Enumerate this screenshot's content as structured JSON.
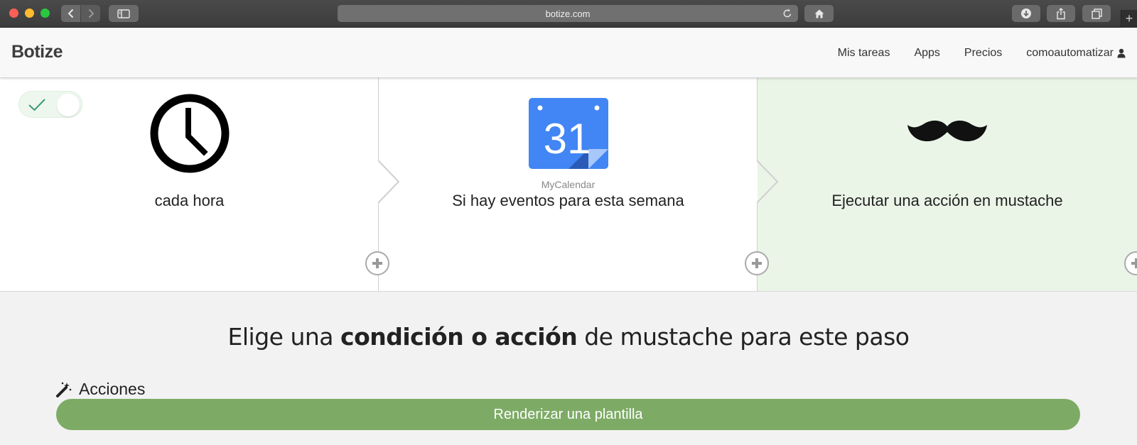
{
  "browser": {
    "url": "botize.com",
    "icons": {
      "back": "chevron-left-icon",
      "forward": "chevron-right-icon",
      "sidebar": "sidebar-icon",
      "reload": "reload-icon",
      "home": "home-icon",
      "download": "download-icon",
      "share": "share-icon",
      "tabs": "tabs-overview-icon",
      "new_tab": "plus-icon"
    },
    "new_tab_label": "+"
  },
  "header": {
    "brand": "Botize",
    "nav": [
      {
        "label": "Mis tareas"
      },
      {
        "label": "Apps"
      },
      {
        "label": "Precios"
      },
      {
        "label": "comoautomatizar",
        "icon": "user-icon"
      }
    ]
  },
  "steps": [
    {
      "title": "cada hora",
      "icon": "clock-icon"
    },
    {
      "title": "Si hay eventos para esta semana",
      "subtitle": "MyCalendar",
      "icon": "calendar-icon",
      "icon_text": "31"
    },
    {
      "title": "Ejecutar una acción en mustache",
      "icon": "mustache-icon"
    }
  ],
  "toggle": {
    "state": "on",
    "icon": "check-icon"
  },
  "prompt": {
    "prefix": "Elige una ",
    "bold": "condición o acción",
    "suffix": " de mustache para este paso"
  },
  "actions": {
    "label": "Acciones",
    "icon": "magic-wand-icon",
    "items": [
      {
        "label": "Renderizar una plantilla"
      }
    ]
  },
  "colors": {
    "accent_green": "#7dab66",
    "active_step_bg": "#eaf5e7",
    "calendar_blue": "#4285f4"
  }
}
